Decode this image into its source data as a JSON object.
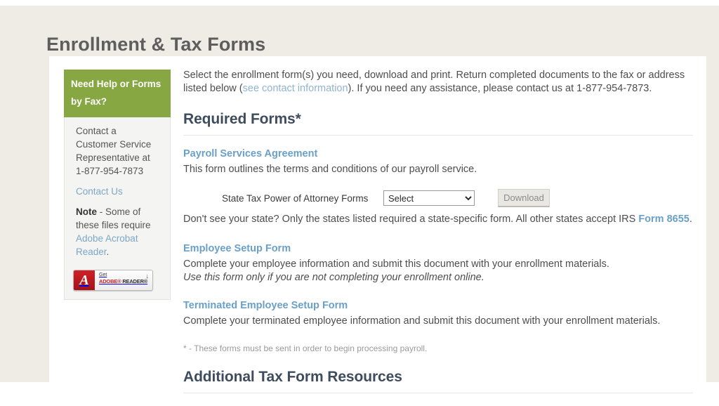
{
  "page": {
    "title": "Enrollment & Tax Forms"
  },
  "sidebar": {
    "header": "Need Help or Forms by Fax?",
    "contact_text": "Contact a Customer Service Representative at 1-877-954-7873",
    "contact_us_link": "Contact Us",
    "note_label": "Note",
    "note_text_before": " - Some of these files require ",
    "note_link": "Adobe Acrobat Reader",
    "note_text_after": ".",
    "adobe_badge": {
      "icon_glyph": "A",
      "get_label": "Get",
      "brand": "ADOBE®",
      "product": "READER®",
      "arrow_icon": "↓"
    }
  },
  "main": {
    "intro_part1": "Select the enrollment form(s) you need, download and print. Return completed documents to the fax or address listed below (",
    "intro_link": "see contact information",
    "intro_part2": "). If you need any assistance, please contact us at 1-877-954-7873.",
    "required_heading": "Required Forms*",
    "forms": [
      {
        "link": "Payroll Services Agreement",
        "desc": "This form outlines the terms and conditions of our payroll service."
      },
      {
        "link": "Employee Setup Form",
        "desc": "Complete your employee information and submit this document with your enrollment materials.",
        "desc_italic": "Use this form only if you are not completing your enrollment online."
      },
      {
        "link": "Terminated Employee Setup Form",
        "desc": "Complete your terminated employee information and submit this document with your enrollment materials."
      }
    ],
    "poa": {
      "label": "State Tax Power of Attorney Forms",
      "select_value": "Select",
      "select_options": [
        "Select"
      ],
      "download_label": "Download"
    },
    "state_note_part1": "Don't see your state? Only the states listed required a state-specific form. All other states accept IRS ",
    "state_note_link": "Form 8655",
    "state_note_part2": ".",
    "footnote": "* - These forms must be sent in order to begin processing payroll.",
    "additional_heading": "Additional Tax Form Resources"
  },
  "colors": {
    "page_background": "#efece5",
    "panel_background": "#ffffff",
    "sidebar_header_green": "#87a743",
    "heading_navy": "#3e4c5e",
    "link_blue": "#6aa0c8",
    "link_light_blue": "#8fb4d0",
    "adobe_red": "#cf2026"
  }
}
